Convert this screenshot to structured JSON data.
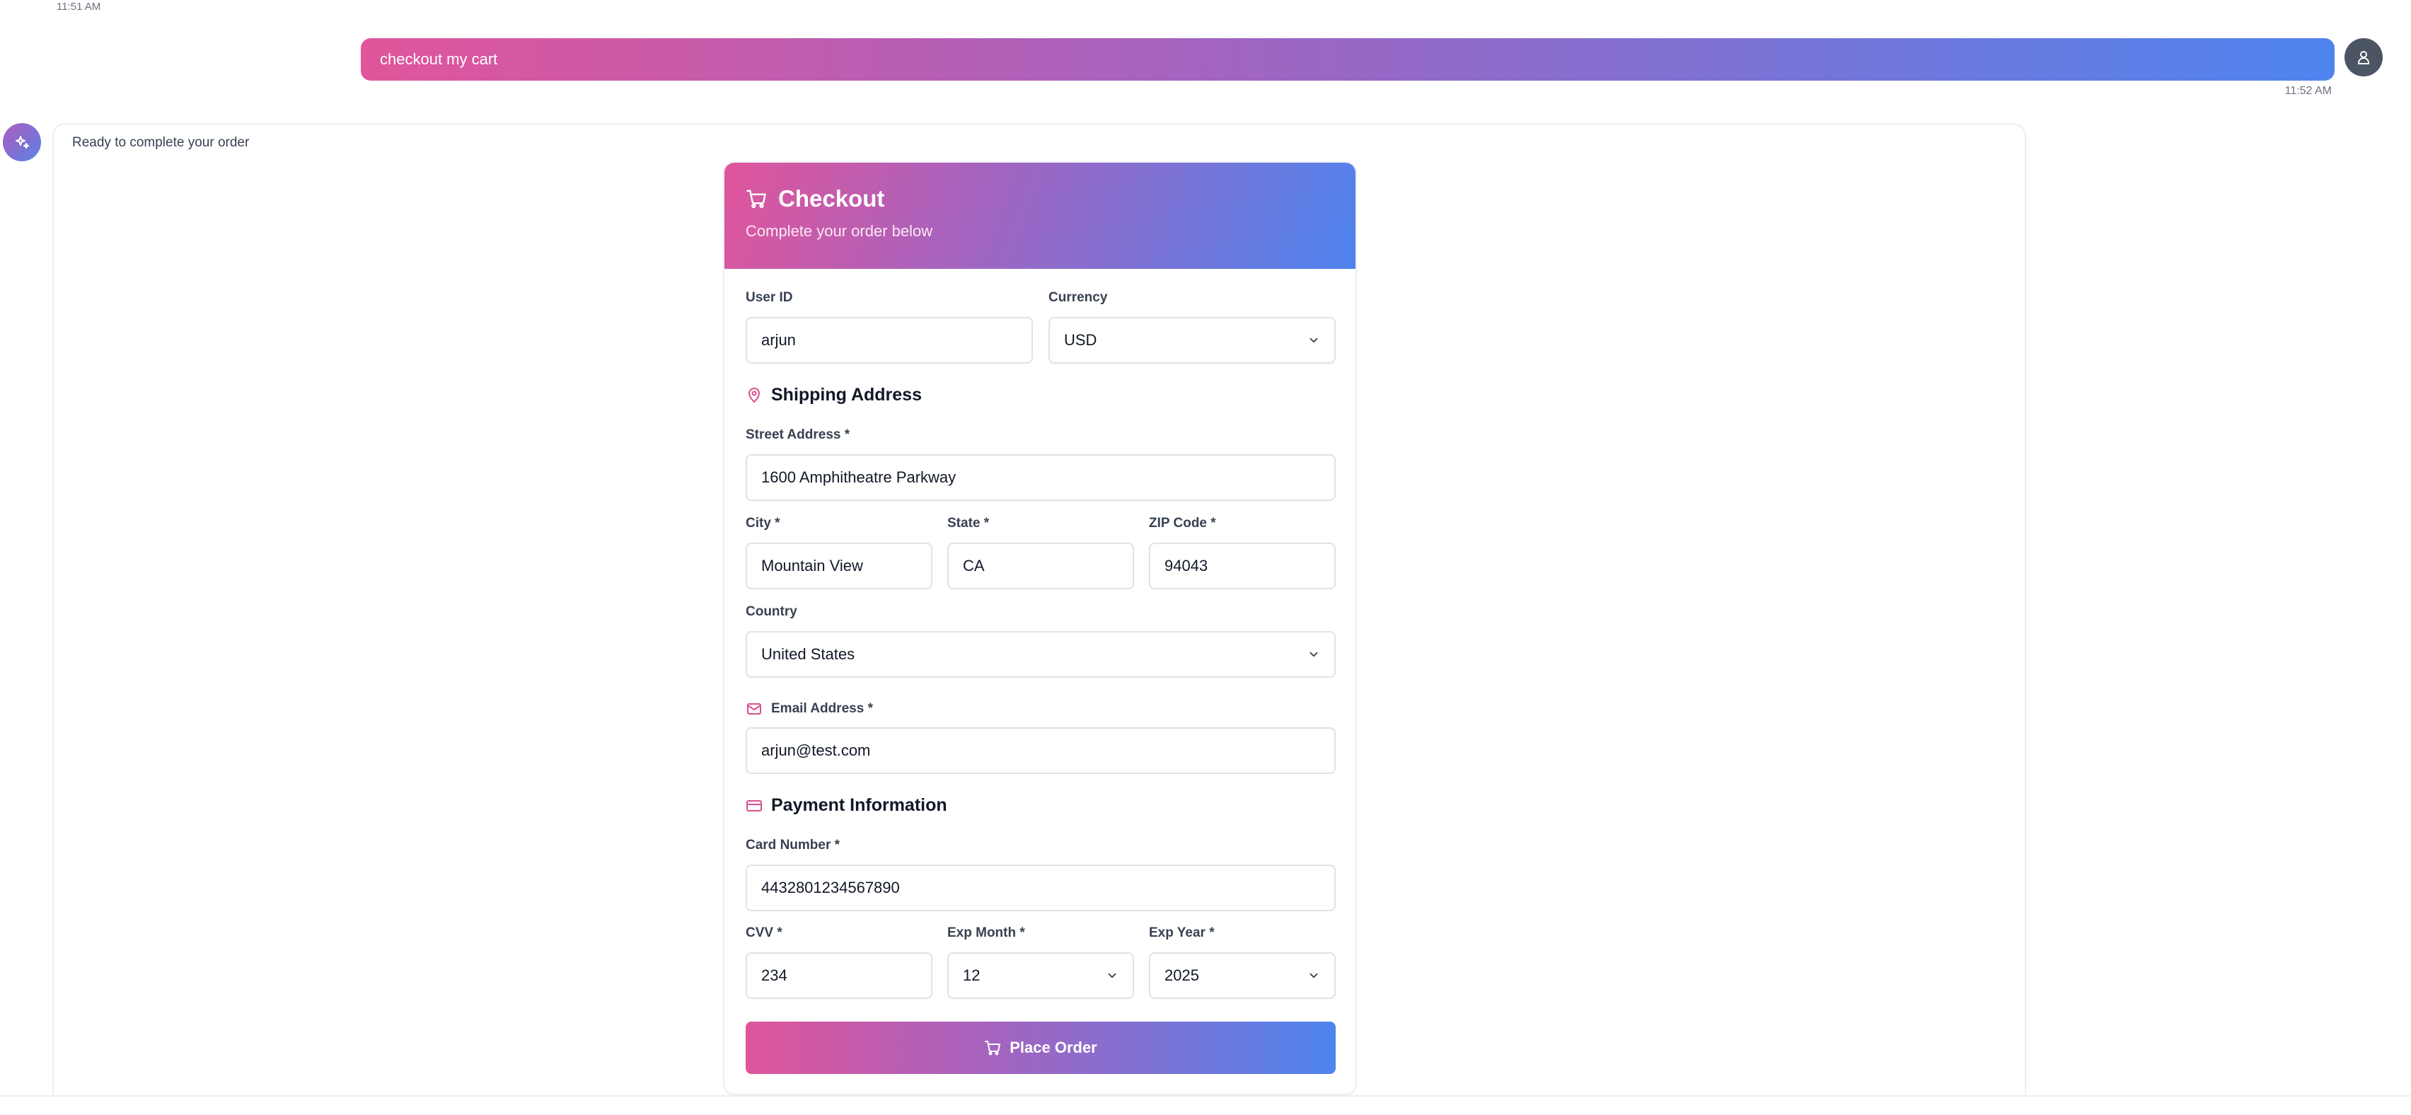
{
  "chat": {
    "top_timestamp": "11:51 AM",
    "user_message": "checkout my cart",
    "user_timestamp": "11:52 AM",
    "bot_message": "Ready to complete your order"
  },
  "checkout": {
    "title": "Checkout",
    "subtitle": "Complete your order below",
    "user_id_label": "User ID",
    "user_id_value": "arjun",
    "currency_label": "Currency",
    "currency_value": "USD",
    "shipping_title": "Shipping Address",
    "street_label": "Street Address *",
    "street_value": "1600 Amphitheatre Parkway",
    "city_label": "City *",
    "city_value": "Mountain View",
    "state_label": "State *",
    "state_value": "CA",
    "zip_label": "ZIP Code *",
    "zip_value": "94043",
    "country_label": "Country",
    "country_value": "United States",
    "email_label": "Email Address *",
    "email_value": "arjun@test.com",
    "payment_title": "Payment Information",
    "card_label": "Card Number *",
    "card_value": "4432801234567890",
    "cvv_label": "CVV *",
    "cvv_value": "234",
    "exp_month_label": "Exp Month *",
    "exp_month_value": "12",
    "exp_year_label": "Exp Year *",
    "exp_year_value": "2025",
    "submit_label": "Place Order"
  },
  "colors": {
    "accent_pink": "#e0559b",
    "accent_blue": "#4e84ee",
    "icon_pink": "#db4f8f"
  },
  "icons": {
    "cart": "shopping-cart-icon",
    "pin": "map-pin-icon",
    "mail": "mail-icon",
    "card": "credit-card-icon",
    "user": "user-icon",
    "sparkle": "sparkle-icon",
    "chevron": "chevron-down-icon"
  }
}
